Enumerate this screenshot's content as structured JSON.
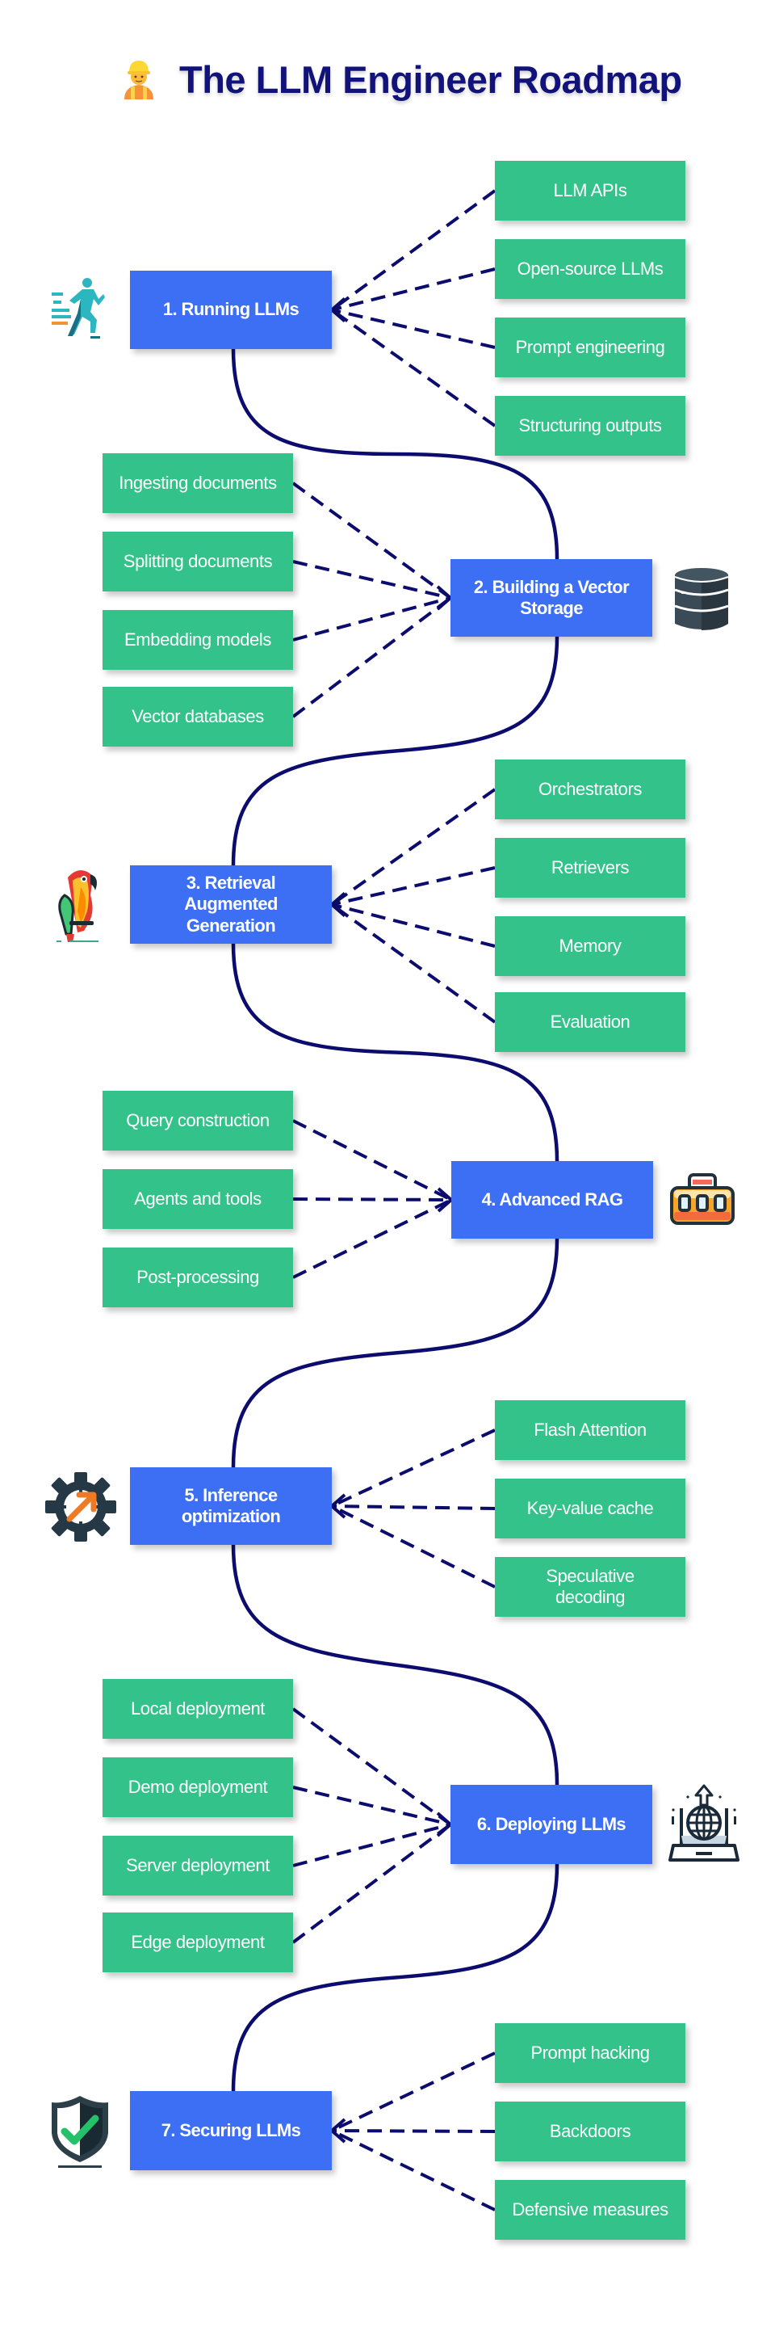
{
  "title": {
    "text": "The LLM Engineer Roadmap",
    "icon": "construction-worker-icon"
  },
  "colors": {
    "title": "#12137a",
    "main_node": "#3d6ff5",
    "sub_node": "#33c28a",
    "connector": "#0c0c6e",
    "node_text": "#ffffff"
  },
  "steps": [
    {
      "label": "1. Running LLMs",
      "icon": "running-person-icon",
      "side": "left",
      "topics": [
        "LLM APIs",
        "Open-source LLMs",
        "Prompt engineering",
        "Structuring outputs"
      ]
    },
    {
      "label": "2. Building a Vector Storage",
      "icon": "database-icon",
      "side": "right",
      "topics": [
        "Ingesting documents",
        "Splitting documents",
        "Embedding models",
        "Vector databases"
      ]
    },
    {
      "label": "3. Retrieval Augmented Generation",
      "icon": "parrot-icon",
      "side": "left",
      "topics": [
        "Orchestrators",
        "Retrievers",
        "Memory",
        "Evaluation"
      ]
    },
    {
      "label": "4. Advanced RAG",
      "icon": "toolbox-icon",
      "side": "right",
      "topics": [
        "Query construction",
        "Agents and tools",
        "Post-processing"
      ]
    },
    {
      "label": "5. Inference optimization",
      "icon": "gear-arrow-icon",
      "side": "left",
      "topics": [
        "Flash Attention",
        "Key-value cache",
        "Speculative decoding"
      ]
    },
    {
      "label": "6. Deploying LLMs",
      "icon": "laptop-globe-upload-icon",
      "side": "right",
      "topics": [
        "Local deployment",
        "Demo deployment",
        "Server deployment",
        "Edge deployment"
      ]
    },
    {
      "label": "7. Securing LLMs",
      "icon": "shield-check-icon",
      "side": "left",
      "topics": [
        "Prompt hacking",
        "Backdoors",
        "Defensive measures"
      ]
    }
  ]
}
